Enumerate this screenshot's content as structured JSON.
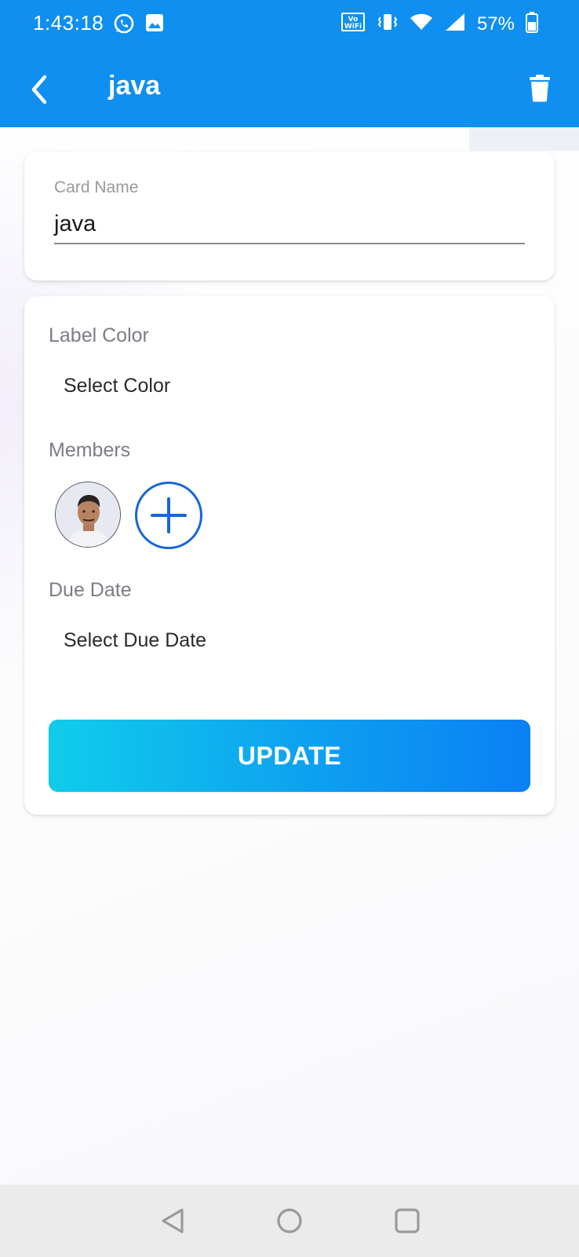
{
  "status_bar": {
    "time": "1:43:18",
    "battery": "57%",
    "icons": [
      "whatsapp-icon",
      "image-icon",
      "vowifi-icon",
      "vibrate-icon",
      "wifi-icon",
      "signal-icon",
      "battery-icon"
    ]
  },
  "app_bar": {
    "title": "java",
    "back_icon": "chevron-left-icon",
    "delete_icon": "trash-icon",
    "color": "#0f8ff0"
  },
  "card_name": {
    "label": "Card Name",
    "value": "java"
  },
  "details": {
    "label_color_heading": "Label Color",
    "label_color_action": "Select Color",
    "members_heading": "Members",
    "due_date_heading": "Due Date",
    "due_date_action": "Select Due Date",
    "update_label": "UPDATE"
  },
  "nav_bar": {
    "icons": [
      "back-triangle-icon",
      "home-circle-icon",
      "recents-square-icon"
    ]
  }
}
